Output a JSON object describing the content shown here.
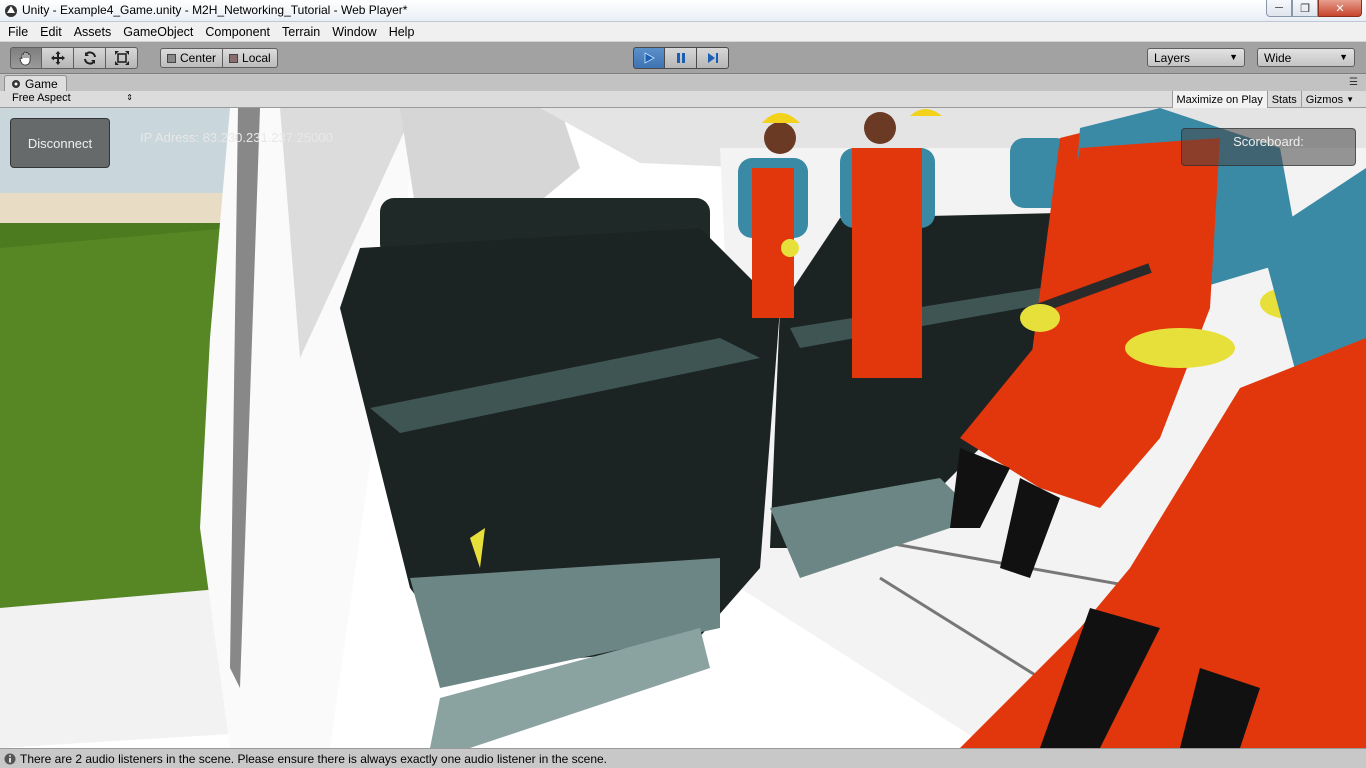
{
  "window": {
    "title": "Unity - Example4_Game.unity - M2H_Networking_Tutorial - Web Player*",
    "controls": [
      "minimize-icon",
      "maximize-icon",
      "close-icon"
    ]
  },
  "menu": [
    "File",
    "Edit",
    "Assets",
    "GameObject",
    "Component",
    "Terrain",
    "Window",
    "Help"
  ],
  "toolbar": {
    "pivot_center": "Center",
    "pivot_local": "Local",
    "layers": "Layers",
    "layout": "Wide"
  },
  "game_view": {
    "tab": "Game",
    "aspect": "Free Aspect",
    "maximize_on_play": "Maximize on Play",
    "stats": "Stats",
    "gizmos": "Gizmos"
  },
  "game_ui": {
    "disconnect": "Disconnect",
    "ip_address": "IP Adress: 83.230.231.237:25000",
    "scoreboard": "Scoreboard:"
  },
  "status": {
    "message": "There are 2 audio listeners in the scene. Please ensure there is always exactly one audio listener in the scene."
  },
  "colors": {
    "toolbar_bg": "#a2a2a2",
    "play_active": "#3e74b3",
    "seat": "#1b2422",
    "overalls": "#e2360d",
    "shirt": "#3a8aa6",
    "glove": "#e8e03a"
  }
}
